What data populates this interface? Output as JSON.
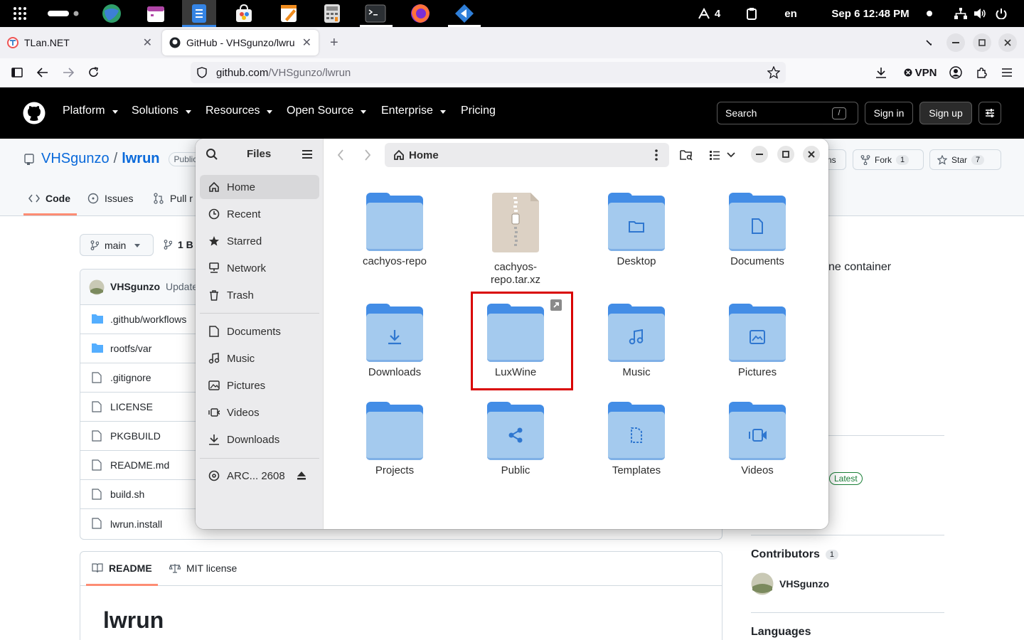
{
  "topbar": {
    "notif_count": "4",
    "lang": "en",
    "datetime": "Sep 6  12:48 PM"
  },
  "browser": {
    "tabs": [
      {
        "title": "TLan.NET"
      },
      {
        "title": "GitHub - VHSgunzo/lwru"
      }
    ],
    "url_host": "github.com",
    "url_path": "/VHSgunzo/lwrun",
    "vpn": "VPN"
  },
  "github": {
    "nav": [
      "Platform",
      "Solutions",
      "Resources",
      "Open Source",
      "Enterprise",
      "Pricing"
    ],
    "search": "Search",
    "search_key": "/",
    "sign_in": "Sign in",
    "sign_up": "Sign up",
    "owner": "VHSgunzo",
    "sep": "/",
    "repo": "lwrun",
    "visibility": "Public",
    "tabs": {
      "code": "Code",
      "issues": "Issues",
      "pull": "Pull r"
    },
    "notif_partial": "ns",
    "fork": "Fork",
    "fork_count": "1",
    "star": "Star",
    "star_count": "7",
    "branch": "main",
    "branches_partial": "1 B",
    "commit_user": "VHSgunzo",
    "commit_msg": "Update",
    "files": [
      ".github/workflows",
      "rootfs/var",
      ".gitignore",
      "LICENSE",
      "PKGBUILD",
      "README.md",
      "build.sh",
      "lwrun.install"
    ],
    "readme_tab": "README",
    "license_tab": "MIT license",
    "readme_title": "lwrun",
    "about_partial": "ne container",
    "latest": "Latest",
    "contributors": "Contributors",
    "contributors_count": "1",
    "contributor": "VHSgunzo",
    "languages": "Languages"
  },
  "files_app": {
    "sidebar_title": "Files",
    "places": [
      "Home",
      "Recent",
      "Starred",
      "Network",
      "Trash"
    ],
    "bookmarks": [
      "Documents",
      "Music",
      "Pictures",
      "Videos",
      "Downloads"
    ],
    "device": "ARC... 2608",
    "location": "Home",
    "items": [
      {
        "name": "cachyos-repo"
      },
      {
        "name": "cachyos-repo.tar.xz",
        "line1": "cachyos-",
        "line2": "repo.tar.xz"
      },
      {
        "name": "Desktop"
      },
      {
        "name": "Documents"
      },
      {
        "name": "Downloads"
      },
      {
        "name": "LuxWine"
      },
      {
        "name": "Music"
      },
      {
        "name": "Pictures"
      },
      {
        "name": "Projects"
      },
      {
        "name": "Public"
      },
      {
        "name": "Templates"
      },
      {
        "name": "Videos"
      }
    ]
  },
  "colors": {
    "folder": "#438de6",
    "folder_front": "#a4caee",
    "highlight": "#d90000"
  }
}
